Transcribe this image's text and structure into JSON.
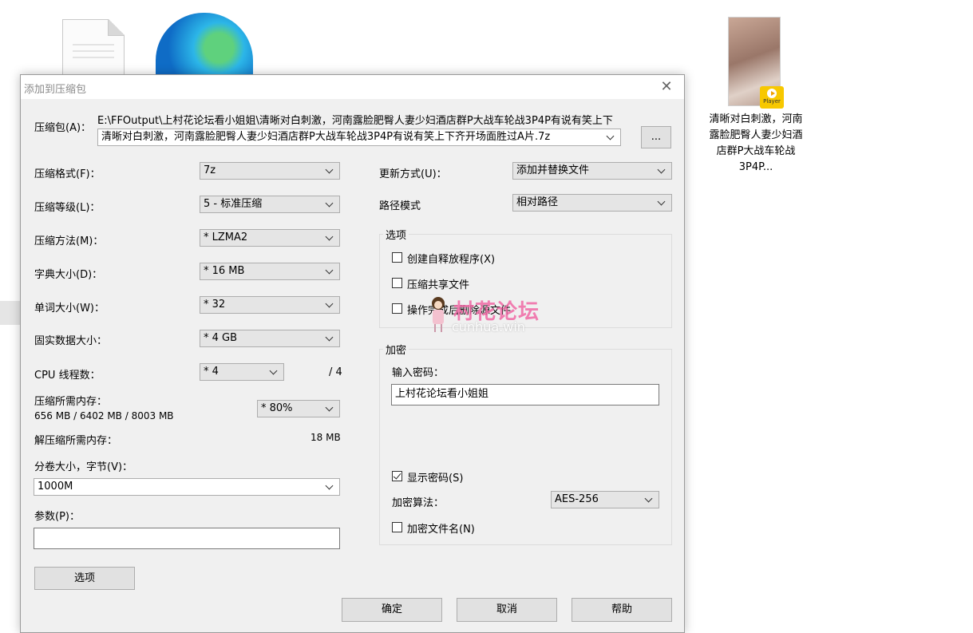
{
  "desktop": {
    "video_caption": "清晰对白刺激，河南露脸肥臀人妻少妇酒店群P大战车轮战3P4P...",
    "player_badge": "Player",
    "peek_1": "",
    "peek_2": ""
  },
  "dialog": {
    "title": "添加到压缩包",
    "close_glyph": "✕",
    "archive_label": "压缩包(A)：",
    "archive_path_line": "E:\\FFOutput\\上村花论坛看小姐姐\\清晰对白刺激，河南露脸肥臀人妻少妇酒店群P大战车轮战3P4P有说有笑上下",
    "archive_combo_value": "清晰对白刺激，河南露脸肥臀人妻少妇酒店群P大战车轮战3P4P有说有笑上下齐开场面胜过A片.7z",
    "browse_label": "...",
    "format_label": "压缩格式(F)：",
    "format_value": "7z",
    "level_label": "压缩等级(L)：",
    "level_value": "5 - 标准压缩",
    "method_label": "压缩方法(M)：",
    "method_value": "* LZMA2",
    "dict_label": "字典大小(D)：",
    "dict_value": "* 16 MB",
    "word_label": "单词大小(W)：",
    "word_value": "* 32",
    "solid_label": "固实数据大小：",
    "solid_value": "* 4 GB",
    "cpu_label": "CPU 线程数：",
    "cpu_value": "* 4",
    "cpu_max": "/ 4",
    "mem_comp_label": "压缩所需内存：",
    "mem_comp_detail": "656 MB / 6402 MB / 8003 MB",
    "mem_percent_value": "* 80%",
    "mem_decomp_label": "解压缩所需内存：",
    "mem_decomp_value": "18 MB",
    "volume_label": "分卷大小，字节(V)：",
    "volume_value": "1000M",
    "params_label": "参数(P)：",
    "params_value": "",
    "options_button": "选项",
    "update_label": "更新方式(U)：",
    "update_value": "添加并替换文件",
    "path_label": "路径模式",
    "path_value": "相对路径",
    "options_group_title": "选项",
    "opt_sfx": "创建自释放程序(X)",
    "opt_shared": "压缩共享文件",
    "opt_delete": "操作完成后删除源文件",
    "encrypt_group_title": "加密",
    "password_label": "输入密码：",
    "password_value": "上村花论坛看小姐姐",
    "show_password": "显示密码(S)",
    "enc_method_label": "加密算法：",
    "enc_method_value": "AES-256",
    "encrypt_names": "加密文件名(N)",
    "ok_button": "确定",
    "cancel_button": "取消",
    "help_button": "帮助"
  },
  "watermark": {
    "text": "村花论坛",
    "url": "cunhua.win"
  },
  "state": {
    "show_password_checked": true,
    "opt_sfx_checked": false,
    "opt_shared_checked": false,
    "opt_delete_checked": false,
    "encrypt_names_checked": false
  }
}
